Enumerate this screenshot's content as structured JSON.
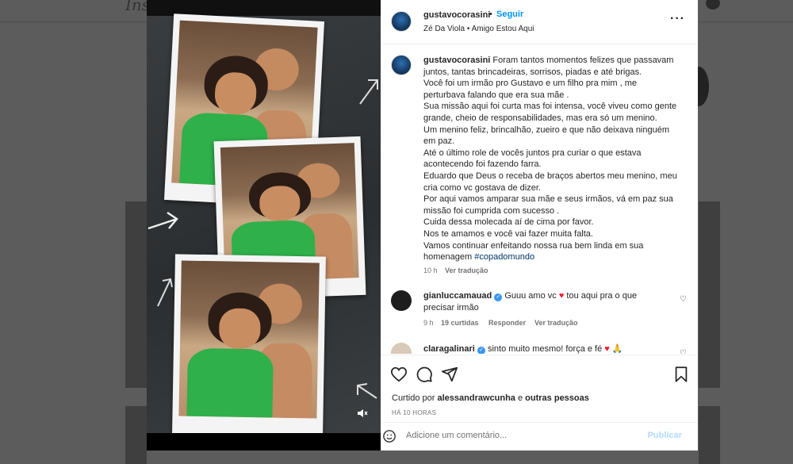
{
  "background": {
    "logo": "Ins"
  },
  "header": {
    "username": "gustavocorasini",
    "separator": "•",
    "follow_label": "Seguir",
    "audio": "Zé Da Viola • Amigo Estou Aqui",
    "more_icon": "more-horizontal-icon"
  },
  "caption": {
    "username": "gustavocorasini",
    "lines": [
      "Foram tantos momentos felizes que passavam juntos, tantas brincadeiras, sorrisos, piadas e até brigas.",
      "Você foi um irmão pro Gustavo e um filho pra mim , me perturbava falando que era sua mãe .",
      "Sua missão aqui foi curta mas foi intensa, você viveu como gente grande, cheio de responsabilidades, mas era só um menino.",
      "Um menino feliz, brincalhão, zueiro e que não deixava ninguém em paz.",
      "Até o último role de vocês juntos pra curiar o que estava acontecendo foi fazendo farra.",
      "Eduardo que Deus o receba de braços abertos meu menino, meu cria como vc gostava de dizer.",
      "Por aqui vamos amparar sua mãe e seus irmãos, vá em paz sua missão foi cumprida com sucesso .",
      "Cuida dessa molecada aí de cima por favor.",
      "Nos te amamos e você vai fazer muita falta.",
      "Vamos continuar enfeitando nossa rua bem linda em sua homenagem"
    ],
    "hashtag": "#copadomundo",
    "time": "10 h",
    "translate": "Ver tradução"
  },
  "comments": [
    {
      "username": "gianluccamauad",
      "text_a": "Guuu amo vc",
      "text_b": "tou aqui pra o que precisar irmão",
      "time": "9 h",
      "likes": "19 curtidas",
      "reply": "Responder",
      "translate": "Ver tradução"
    },
    {
      "username": "claragalinari",
      "text_a": "sinto muito mesmo! força e fé"
    }
  ],
  "actions": {
    "liked_prefix": "Curtido por",
    "liked_user": "alessandrawcunha",
    "liked_and": "e",
    "liked_others": "outras pessoas",
    "time": "HÁ 10 HORAS"
  },
  "add_comment": {
    "placeholder": "Adicione um comentário...",
    "post_label": "Publicar"
  },
  "colors": {
    "link": "#0095f6",
    "heart": "#ed1c2f",
    "verified": "#3897f0"
  }
}
